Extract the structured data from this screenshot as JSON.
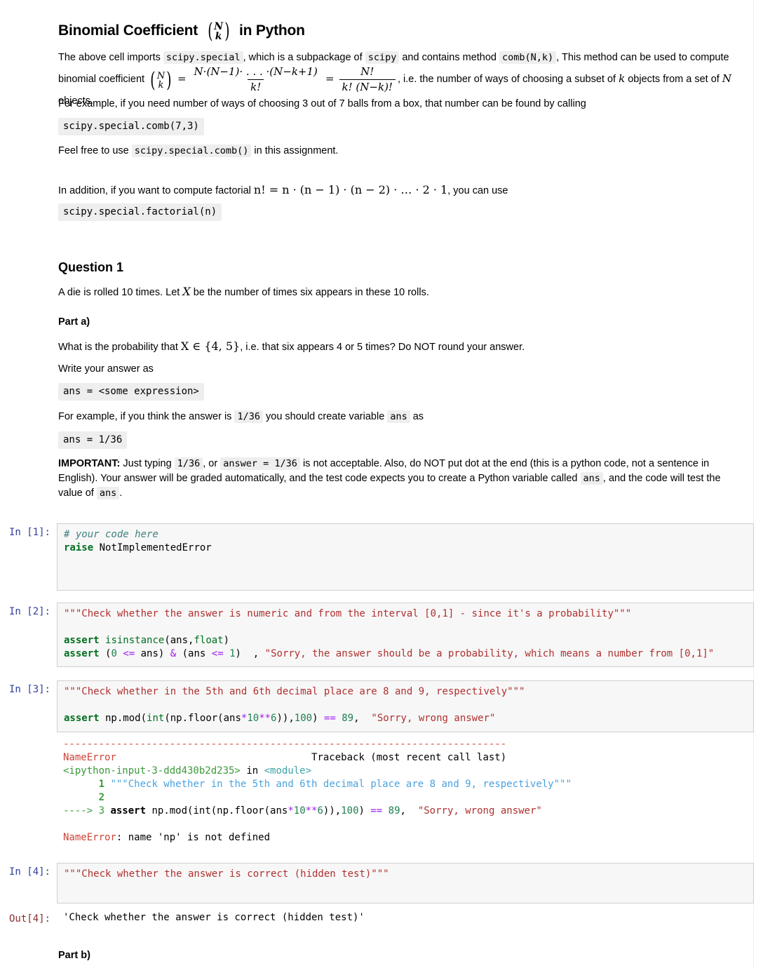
{
  "markdown": {
    "title_pre": "Binomial Coefficient",
    "title_post": "in Python",
    "p1_a": "The above cell imports",
    "p1_code1": "scipy.special",
    "p1_b": ", which is a subpackage of",
    "p1_code2": "scipy",
    "p1_c": "and contains method",
    "p1_code3": "comb(N,k)",
    "p1_d": ", This method can be used to compute binomial coefficient",
    "p1_e": ", i.e. the number of ways of choosing a subset of",
    "p1_f": "objects from a set of",
    "p1_g": "objects.",
    "formula_num1": "N·(N−1)· . . . ·(N−k+1)",
    "formula_den1": "k!",
    "formula_num2": "N!",
    "formula_den2": "k! (N−k)!",
    "binom_top": "N",
    "binom_bottom": "k",
    "p2": "For example, if you need number of ways of choosing 3 out of 7 balls from a box, that number can be found by calling",
    "block1": "scipy.special.comb(7,3)",
    "p3_a": "Feel free to use",
    "p3_code": "scipy.special.comb()",
    "p3_b": "in this assignment.",
    "p4_a": "In addition, if you want to compute factorial",
    "p4_math": "n! = n · (n − 1) · (n − 2) ·  …  · 2 · 1",
    "p4_b": ", you can use",
    "block2": "scipy.special.factorial(n)",
    "q1_heading": "Question 1",
    "q1_text_a": "A die is rolled 10 times. Let",
    "q1_var": "X",
    "q1_text_b": "be the number of times six appears in these 10 rolls.",
    "part_a_heading": "Part a)",
    "part_a_text_a": "What is the probability that",
    "part_a_math": "X ∈ {4, 5}",
    "part_a_text_b": ", i.e. that six appears 4 or 5 times? Do NOT round your answer.",
    "write_answer": "Write your answer as",
    "block3": "ans = <some expression>",
    "example_a": "For example, if you think the answer is",
    "example_code1": "1/36",
    "example_b": "you should create variable",
    "example_code2": "ans",
    "example_c": "as",
    "block4": "ans = 1/36",
    "important_label": "IMPORTANT:",
    "important_a": "Just typing",
    "important_code1": "1/36",
    "important_b": ", or",
    "important_code2": "answer = 1/36",
    "important_c": "is not acceptable. Also, do NOT put dot at the end (this is a python code, not a sentence in English). Your answer will be graded automatically, and the test code expects you to create a Python variable called",
    "important_code3": "ans",
    "important_d": ", and the code will test the value of",
    "important_code4": "ans",
    "important_e": ".",
    "part_b_heading": "Part b)"
  },
  "cells": [
    {
      "prompt": "In [1]:",
      "prompt_type": "in",
      "code_lines": [
        "# your code here",
        "raise NotImplementedError"
      ]
    },
    {
      "prompt": "In [2]:",
      "prompt_type": "in",
      "code_lines": [
        "\"\"\"Check whether the answer is numeric and from the interval [0,1] - since it's a probability\"\"\"",
        "",
        "assert isinstance(ans,float)",
        "assert (0 <= ans) & (ans <= 1)  , \"Sorry, the answer should be a probability, which means a number from [0,1]\""
      ]
    },
    {
      "prompt": "In [3]:",
      "prompt_type": "in",
      "code_lines": [
        "\"\"\"Check whether in the 5th and 6th decimal place are 8 and 9, respectively\"\"\"",
        "",
        "assert np.mod(int(np.floor(ans*10**6)),100) == 89,  \"Sorry, wrong answer\""
      ]
    },
    {
      "prompt": "In [4]:",
      "prompt_type": "in",
      "code_lines": [
        "\"\"\"Check whether the answer is correct (hidden test)\"\"\""
      ]
    }
  ],
  "traceback": {
    "rule": "---------------------------------------------------------------------------",
    "error_name": "NameError",
    "traceback_label": "Traceback (most recent call last)",
    "frame_file": "<ipython-input-3-ddd430b2d235>",
    "frame_in": "in",
    "frame_module": "<module>",
    "line1_no": "1",
    "line1_code": "\"\"\"Check whether in the 5th and 6th decimal place are 8 and 9, respectively\"\"\"",
    "line2_no": "2",
    "arrow": "----> 3",
    "line3_code_a": "assert",
    "line3_code_b": " np.mod(int(np.floor(ans",
    "line3_op1": "*",
    "line3_num1": "10",
    "line3_op2": "**",
    "line3_num2": "6",
    "line3_code_c": ")),",
    "line3_num3": "100",
    "line3_code_d": ") ",
    "line3_op3": "==",
    "line3_num4": " 89",
    "line3_code_e": ",  ",
    "line3_str": "\"Sorry, wrong answer\"",
    "final_error_name": "NameError",
    "final_error_msg": ": name 'np' is not defined"
  },
  "output": {
    "prompt": "Out[4]:",
    "value": "'Check whether the answer is correct (hidden test)'"
  },
  "colors": {
    "in_prompt": "#303F9F",
    "out_prompt": "#8b2d2d",
    "cell_bg": "#f7f7f7",
    "cell_border": "#cfcfcf",
    "keyword": "#007020",
    "string": "#b03030",
    "comment": "#408080",
    "operator": "#a020f0",
    "number": "#208050",
    "traceback_error": "#d04437",
    "traceback_green": "#3a9a3a",
    "traceback_blue": "#4aa3df"
  }
}
